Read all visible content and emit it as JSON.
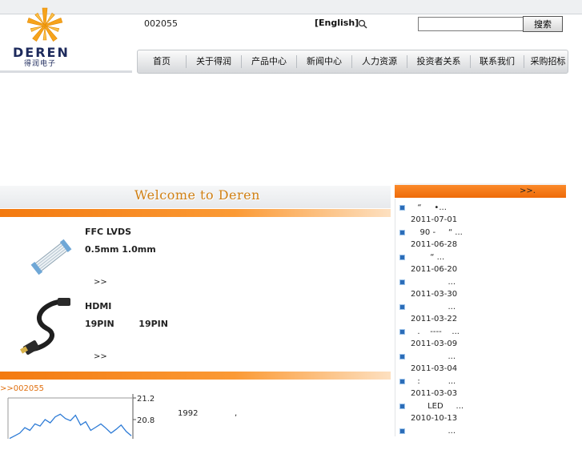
{
  "header": {
    "brand": "DEREN",
    "brand_cn": "得润电子",
    "stock_code": "002055",
    "language_link": "[English]",
    "search_placeholder": "",
    "search_button": "搜索"
  },
  "nav": {
    "items": [
      "首页",
      "关于得润",
      "产品中心",
      "新闻中心",
      "人力资源",
      "投资者关系",
      "联系我们",
      "采购招标"
    ]
  },
  "welcome": {
    "title": "Welcome to Deren"
  },
  "products": [
    {
      "name": "FFC LVDS",
      "spec": "0.5mm  1.0mm",
      "more": ">>"
    },
    {
      "name": "HDMI",
      "spec": "19PIN        19PIN",
      "more": ">>"
    }
  ],
  "news": {
    "more": ">>.",
    "items": [
      {
        "title": "  “     •...",
        "date": "2011-07-01"
      },
      {
        "title": "   90 -     “ ...",
        "date": "2011-06-28"
      },
      {
        "title": "       “ ...",
        "date": "2011-06-20"
      },
      {
        "title": "              ...",
        "date": "2011-03-30"
      },
      {
        "title": "              ...",
        "date": "2011-03-22"
      },
      {
        "title": "  .    ----    ...",
        "date": "2011-03-09"
      },
      {
        "title": "              ...",
        "date": "2011-03-04"
      },
      {
        "title": "  :           ...",
        "date": "2011-03-03"
      },
      {
        "title": "      LED     ...",
        "date": "2010-10-13"
      },
      {
        "title": "              ...",
        "date": ""
      }
    ]
  },
  "stock": {
    "label": ">>002055",
    "ticks": [
      "21.2",
      "20.8"
    ]
  },
  "intro": {
    "year": "1992",
    "comma": ","
  },
  "chart_data": {
    "type": "line",
    "title": "",
    "xlabel": "",
    "ylabel": "",
    "ylim": [
      20.4,
      21.3
    ],
    "y_ticks": [
      21.2,
      20.8
    ],
    "series": [
      {
        "values": [
          20.45,
          20.5,
          20.55,
          20.65,
          20.6,
          20.72,
          20.68,
          20.8,
          20.74,
          20.85,
          20.9,
          20.82,
          20.78,
          20.88,
          20.7,
          20.76,
          20.6,
          20.66,
          20.72,
          20.64,
          20.55,
          20.62,
          20.7,
          20.58,
          20.5
        ]
      }
    ],
    "colors": {
      "line": "#2d7bd6",
      "axis": "#555555"
    }
  }
}
